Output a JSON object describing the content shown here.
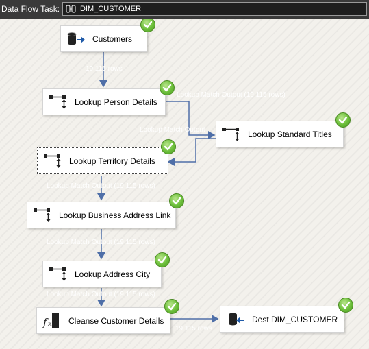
{
  "header": {
    "label": "Data Flow Task:",
    "package_name": "DIM_CUSTOMER"
  },
  "nodes": {
    "customers": {
      "label": "Customers"
    },
    "person": {
      "label": "Lookup Person Details"
    },
    "titles": {
      "label": "Lookup Standard Titles"
    },
    "territory": {
      "label": "Lookup Territory Details"
    },
    "address_link": {
      "label": "Lookup Business Address Link"
    },
    "address_city": {
      "label": "Lookup Address City"
    },
    "cleanse": {
      "label": "Cleanse Customer Details"
    },
    "dest": {
      "label": "Dest DIM_CUSTOMER"
    }
  },
  "paths": {
    "p1": "19 115 rows",
    "p2": "Lookup Match Output (19 115 rows)",
    "p3": "Lookup Match Output",
    "p4": "Lookup Match Output (19 115 rows)",
    "p5": "Lookup Match Output (19 115 rows)",
    "p6": "Lookup Match Output (19 115 rows)",
    "p7": "19 115 rows"
  },
  "colors": {
    "arrow": "#4f6fa8",
    "check": "#6cbf3a",
    "header_bg": "#3a3a3a"
  }
}
